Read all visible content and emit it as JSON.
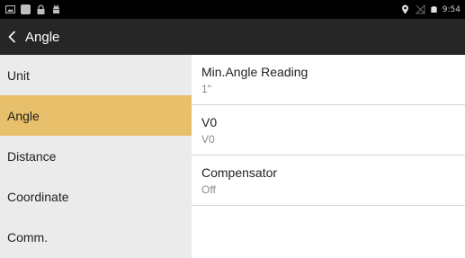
{
  "status_bar": {
    "time": "9:54",
    "left_icons": [
      "gallery-icon",
      "app-icon",
      "lock-icon",
      "android-icon"
    ],
    "right_icons": [
      "location-icon",
      "no-signal-icon",
      "battery-icon"
    ]
  },
  "app_bar": {
    "title": "Angle",
    "back_icon": "chevron-left-icon"
  },
  "sidebar": {
    "items": [
      {
        "label": "Unit",
        "active": false
      },
      {
        "label": "Angle",
        "active": true
      },
      {
        "label": "Distance",
        "active": false
      },
      {
        "label": "Coordinate",
        "active": false
      },
      {
        "label": "Comm.",
        "active": false
      }
    ]
  },
  "settings": [
    {
      "title": "Min.Angle Reading",
      "value": "1\""
    },
    {
      "title": "V0",
      "value": "V0"
    },
    {
      "title": "Compensator",
      "value": "Off"
    }
  ],
  "colors": {
    "status_bar_bg": "#000000",
    "app_bar_bg": "#262626",
    "sidebar_bg": "#ebebeb",
    "active_item_bg": "#e8bf6a",
    "divider": "#d6d6d6"
  }
}
